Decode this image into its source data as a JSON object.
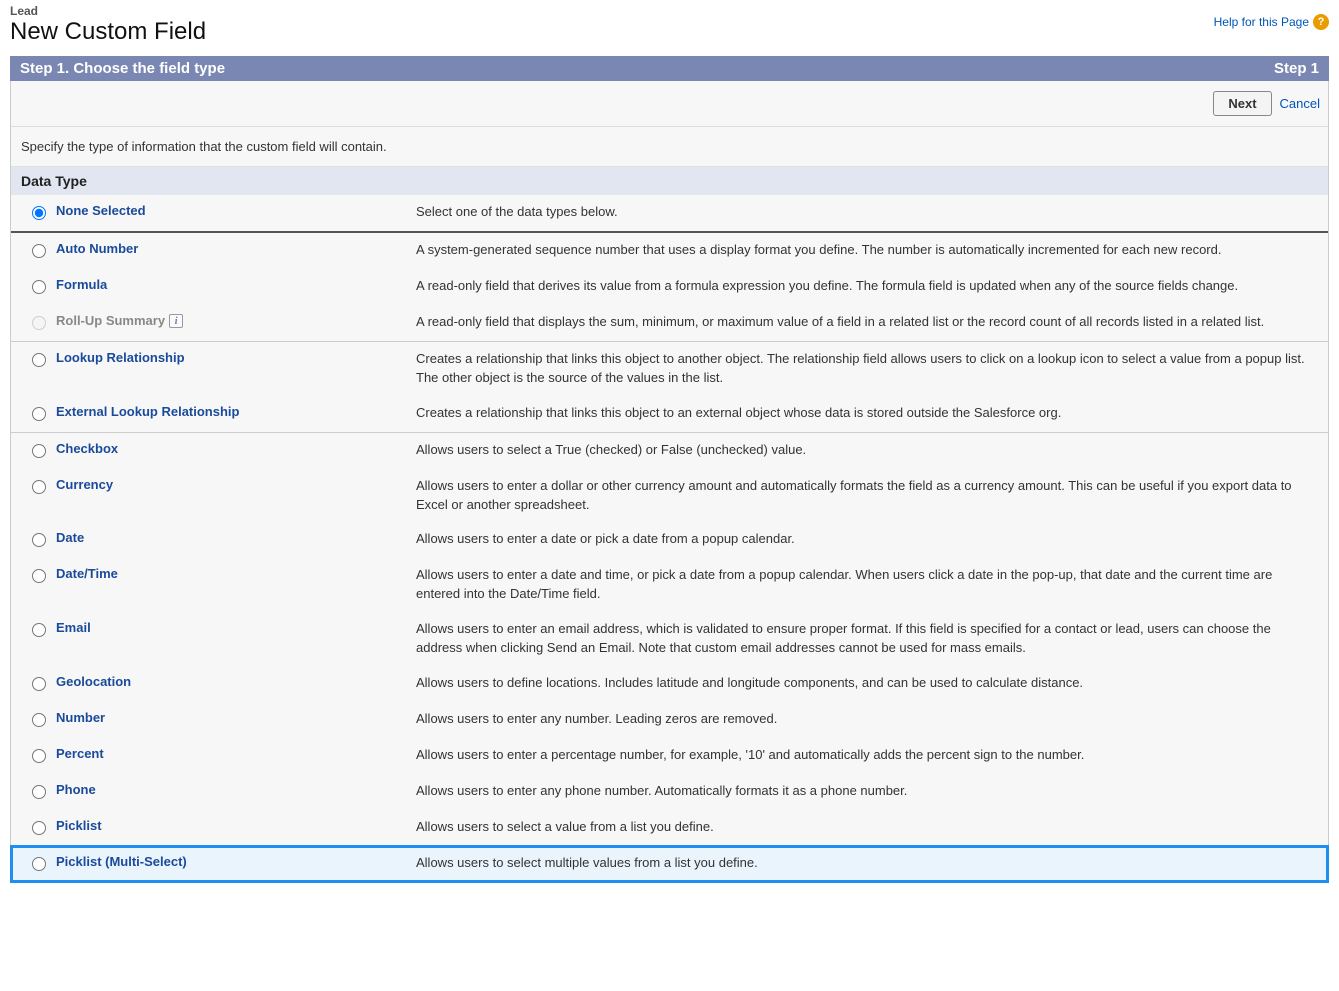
{
  "header": {
    "breadcrumb": "Lead",
    "title": "New Custom Field",
    "help_label": "Help for this Page",
    "help_badge": "?"
  },
  "step_bar": {
    "left": "Step 1. Choose the field type",
    "right": "Step 1"
  },
  "buttons": {
    "next": "Next",
    "cancel": "Cancel"
  },
  "instruction": "Specify the type of information that the custom field will contain.",
  "section_header": "Data Type",
  "none_selected": {
    "label": "None Selected",
    "desc": "Select one of the data types below."
  },
  "info_badge": "i",
  "groups": [
    {
      "items": [
        {
          "key": "auto-number",
          "label": "Auto Number",
          "desc": "A system-generated sequence number that uses a display format you define. The number is automatically incremented for each new record.",
          "disabled": false,
          "info": false
        },
        {
          "key": "formula",
          "label": "Formula",
          "desc": "A read-only field that derives its value from a formula expression you define. The formula field is updated when any of the source fields change.",
          "disabled": false,
          "info": false
        },
        {
          "key": "rollup-summary",
          "label": "Roll-Up Summary",
          "desc": "A read-only field that displays the sum, minimum, or maximum value of a field in a related list or the record count of all records listed in a related list.",
          "disabled": true,
          "info": true
        }
      ]
    },
    {
      "items": [
        {
          "key": "lookup-relationship",
          "label": "Lookup Relationship",
          "desc": "Creates a relationship that links this object to another object. The relationship field allows users to click on a lookup icon to select a value from a popup list. The other object is the source of the values in the list.",
          "disabled": false,
          "info": false
        },
        {
          "key": "external-lookup-relationship",
          "label": "External Lookup Relationship",
          "desc": "Creates a relationship that links this object to an external object whose data is stored outside the Salesforce org.",
          "disabled": false,
          "info": false
        }
      ]
    },
    {
      "items": [
        {
          "key": "checkbox",
          "label": "Checkbox",
          "desc": "Allows users to select a True (checked) or False (unchecked) value.",
          "disabled": false,
          "info": false
        },
        {
          "key": "currency",
          "label": "Currency",
          "desc": "Allows users to enter a dollar or other currency amount and automatically formats the field as a currency amount. This can be useful if you export data to Excel or another spreadsheet.",
          "disabled": false,
          "info": false
        },
        {
          "key": "date",
          "label": "Date",
          "desc": "Allows users to enter a date or pick a date from a popup calendar.",
          "disabled": false,
          "info": false
        },
        {
          "key": "datetime",
          "label": "Date/Time",
          "desc": "Allows users to enter a date and time, or pick a date from a popup calendar. When users click a date in the pop-up, that date and the current time are entered into the Date/Time field.",
          "disabled": false,
          "info": false
        },
        {
          "key": "email",
          "label": "Email",
          "desc": "Allows users to enter an email address, which is validated to ensure proper format. If this field is specified for a contact or lead, users can choose the address when clicking Send an Email. Note that custom email addresses cannot be used for mass emails.",
          "disabled": false,
          "info": false
        },
        {
          "key": "geolocation",
          "label": "Geolocation",
          "desc": "Allows users to define locations. Includes latitude and longitude components, and can be used to calculate distance.",
          "disabled": false,
          "info": false
        },
        {
          "key": "number",
          "label": "Number",
          "desc": "Allows users to enter any number. Leading zeros are removed.",
          "disabled": false,
          "info": false
        },
        {
          "key": "percent",
          "label": "Percent",
          "desc": "Allows users to enter a percentage number, for example, '10' and automatically adds the percent sign to the number.",
          "disabled": false,
          "info": false
        },
        {
          "key": "phone",
          "label": "Phone",
          "desc": "Allows users to enter any phone number. Automatically formats it as a phone number.",
          "disabled": false,
          "info": false
        },
        {
          "key": "picklist",
          "label": "Picklist",
          "desc": "Allows users to select a value from a list you define.",
          "disabled": false,
          "info": false
        },
        {
          "key": "picklist-multiselect",
          "label": "Picklist (Multi-Select)",
          "desc": "Allows users to select multiple values from a list you define.",
          "disabled": false,
          "info": false,
          "highlight": true
        }
      ]
    }
  ]
}
